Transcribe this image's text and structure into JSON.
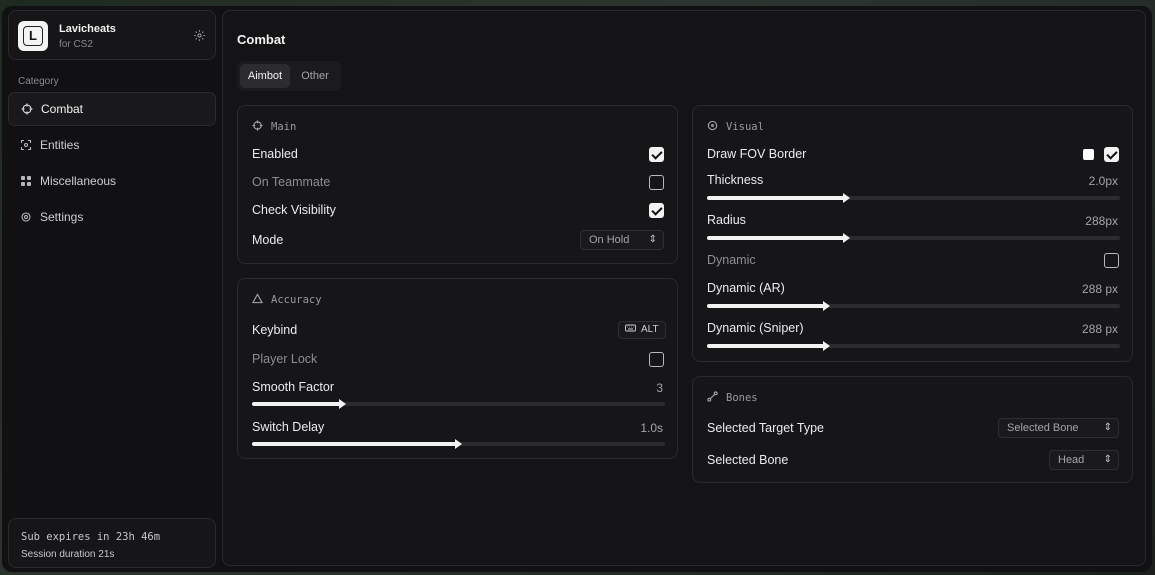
{
  "brand": {
    "logo_letter": "L",
    "name": "Lavicheats",
    "subtitle": "for CS2"
  },
  "sidebar": {
    "category_label": "Category",
    "items": [
      {
        "label": "Combat",
        "icon": "crosshair-icon",
        "active": true
      },
      {
        "label": "Entities",
        "icon": "scan-icon",
        "active": false
      },
      {
        "label": "Miscellaneous",
        "icon": "grid-icon",
        "active": false
      },
      {
        "label": "Settings",
        "icon": "gear-icon",
        "active": false
      }
    ]
  },
  "subscription": {
    "expires": "Sub expires in 23h 46m",
    "session": "Session duration 21s"
  },
  "main": {
    "title": "Combat",
    "tabs": [
      {
        "label": "Aimbot",
        "active": true
      },
      {
        "label": "Other",
        "active": false
      }
    ]
  },
  "main_card": {
    "title": "Main",
    "enabled_label": "Enabled",
    "enabled": true,
    "teammate_label": "On Teammate",
    "teammate": false,
    "visibility_label": "Check Visibility",
    "visibility": true,
    "mode_label": "Mode",
    "mode_value": "On Hold"
  },
  "accuracy_card": {
    "title": "Accuracy",
    "keybind_label": "Keybind",
    "keybind_value": "ALT",
    "player_lock_label": "Player Lock",
    "player_lock": false,
    "smooth_label": "Smooth Factor",
    "smooth_value": "3",
    "smooth_fraction": 0.22,
    "switch_label": "Switch Delay",
    "switch_value": "1.0s",
    "switch_fraction": 0.5
  },
  "visual_card": {
    "title": "Visual",
    "fov_label": "Draw FOV Border",
    "fov_color": "#ffffff",
    "fov_enabled": true,
    "thickness_label": "Thickness",
    "thickness_value": "2.0px",
    "thickness_fraction": 0.34,
    "radius_label": "Radius",
    "radius_value": "288px",
    "radius_fraction": 0.34,
    "dynamic_label": "Dynamic",
    "dynamic": false,
    "dyn_ar_label": "Dynamic (AR)",
    "dyn_ar_value": "288 px",
    "dyn_ar_fraction": 0.29,
    "dyn_sniper_label": "Dynamic (Sniper)",
    "dyn_sniper_value": "288 px",
    "dyn_sniper_fraction": 0.29
  },
  "bones_card": {
    "title": "Bones",
    "target_type_label": "Selected Target Type",
    "target_type_value": "Selected Bone",
    "bone_label": "Selected Bone",
    "bone_value": "Head"
  }
}
